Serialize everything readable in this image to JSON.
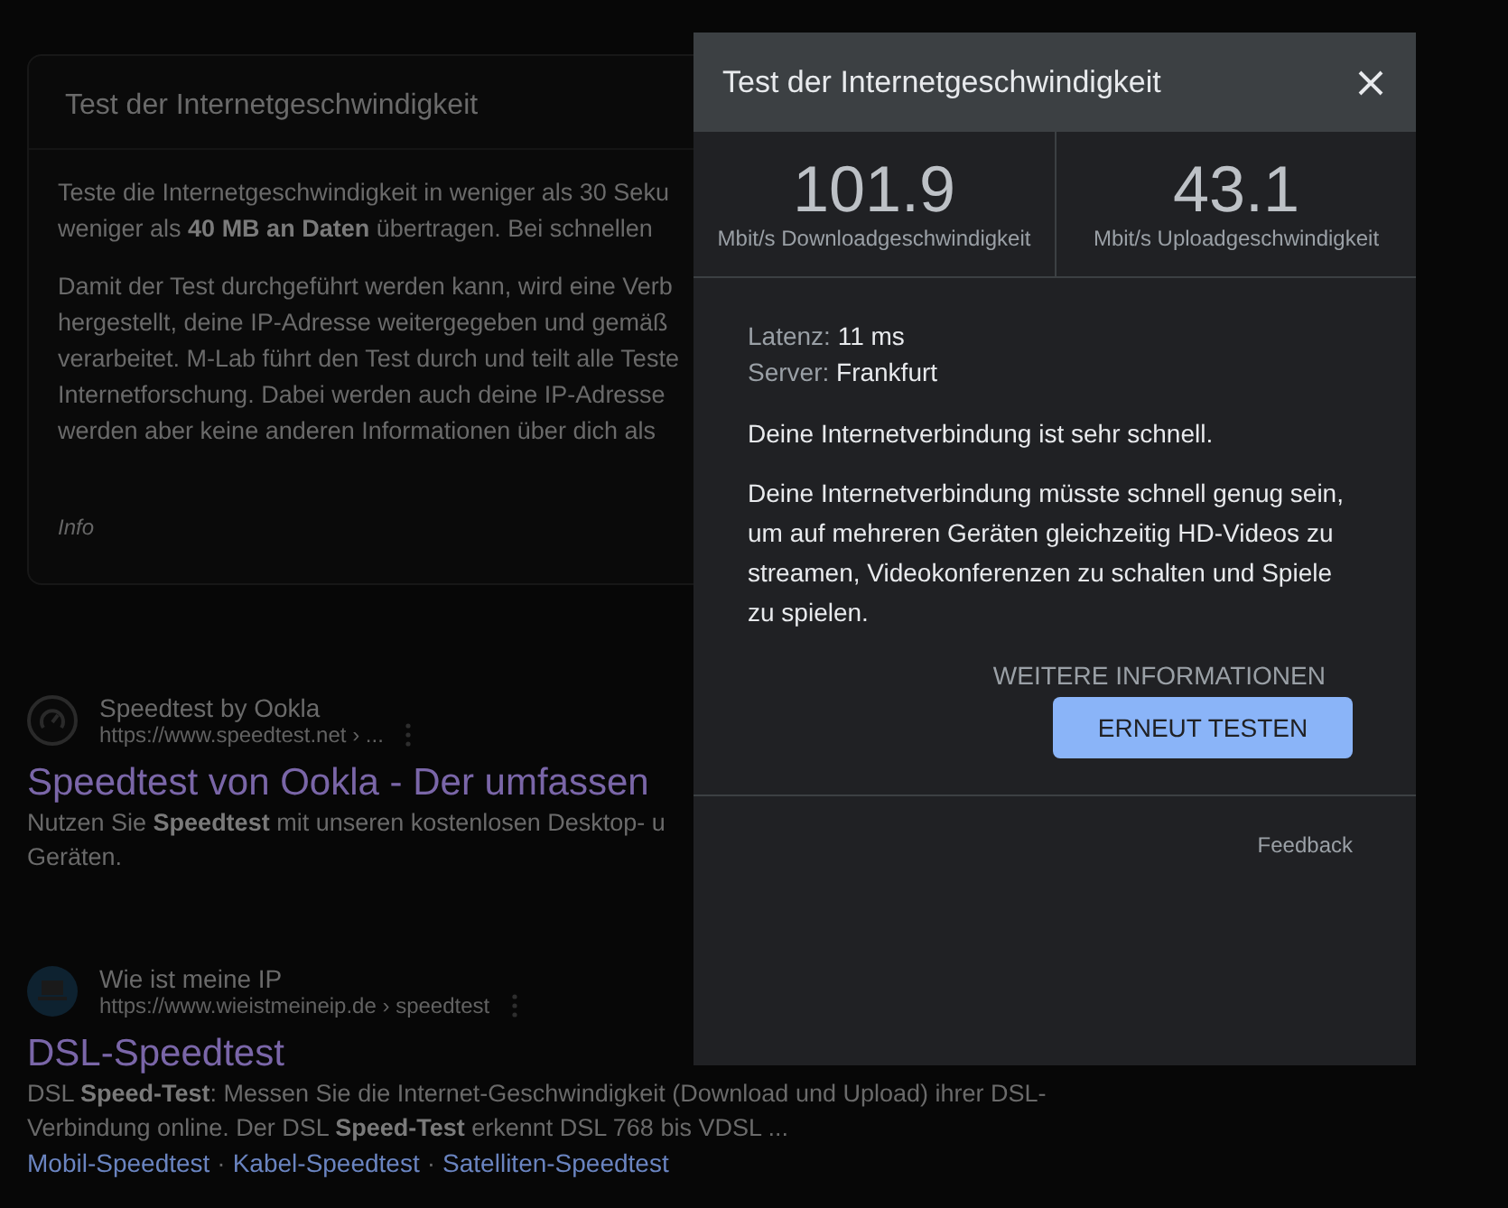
{
  "info_card": {
    "title": "Test der Internetgeschwindigkeit",
    "paragraphs": [
      [
        "Teste die Internetgeschwindigkeit in weniger als 30 Seku",
        "weniger als **40 MB an Daten** übertragen. Bei schnellen"
      ],
      [
        "Damit der Test durchgeführt werden kann, wird eine Verb",
        "hergestellt, deine IP-Adresse weitergegeben und gemäß",
        "verarbeitet. M-Lab führt den Test durch und teilt alle Teste",
        "Internetforschung. Dabei werden auch deine IP-Adresse",
        "werden aber keine anderen Informationen über dich als"
      ]
    ],
    "footer": "Info"
  },
  "results": [
    {
      "kind": "gauge",
      "site": "Speedtest by Ookla",
      "url": "https://www.speedtest.net › ...",
      "title": "Speedtest von Ookla - Der umfassen",
      "snippet": [
        "Nutzen Sie **Speedtest** mit unseren kostenlosen Desktop- u",
        "Geräten."
      ]
    },
    {
      "kind": "laptop",
      "site": "Wie ist meine IP",
      "url": "https://www.wieistmeineip.de › speedtest",
      "title": "DSL-Speedtest",
      "snippet": [
        "DSL **Speed-Test**: Messen Sie die Internet-Geschwindigkeit (Download und Upload) ihrer DSL-",
        "Verbindung online. Der DSL **Speed-Test** erkennt DSL 768 bis VDSL ..."
      ],
      "sitelinks": [
        "Mobil-Speedtest",
        "Kabel-Speedtest",
        "Satelliten-Speedtest"
      ],
      "separator": "·"
    }
  ],
  "dialog": {
    "title": "Test der Internetgeschwindigkeit",
    "stats": [
      {
        "value": "101.9",
        "label": "Mbit/s Downloadgeschwindigkeit"
      },
      {
        "value": "43.1",
        "label": "Mbit/s Uploadgeschwindigkeit"
      }
    ],
    "details": [
      {
        "label": "Latenz:",
        "value": "11 ms"
      },
      {
        "label": "Server:",
        "value": "Frankfurt"
      }
    ],
    "summary": "Deine Internetverbindung ist sehr schnell.",
    "explanation": "Deine Internetverbindung müsste schnell genug sein, um auf mehreren Geräten gleichzeitig HD-Videos zu streamen, Videokonferenzen zu schalten und Spiele zu spielen.",
    "more_info": "WEITERE INFORMATIONEN",
    "retest": "ERNEUT TESTEN",
    "feedback": "Feedback"
  }
}
